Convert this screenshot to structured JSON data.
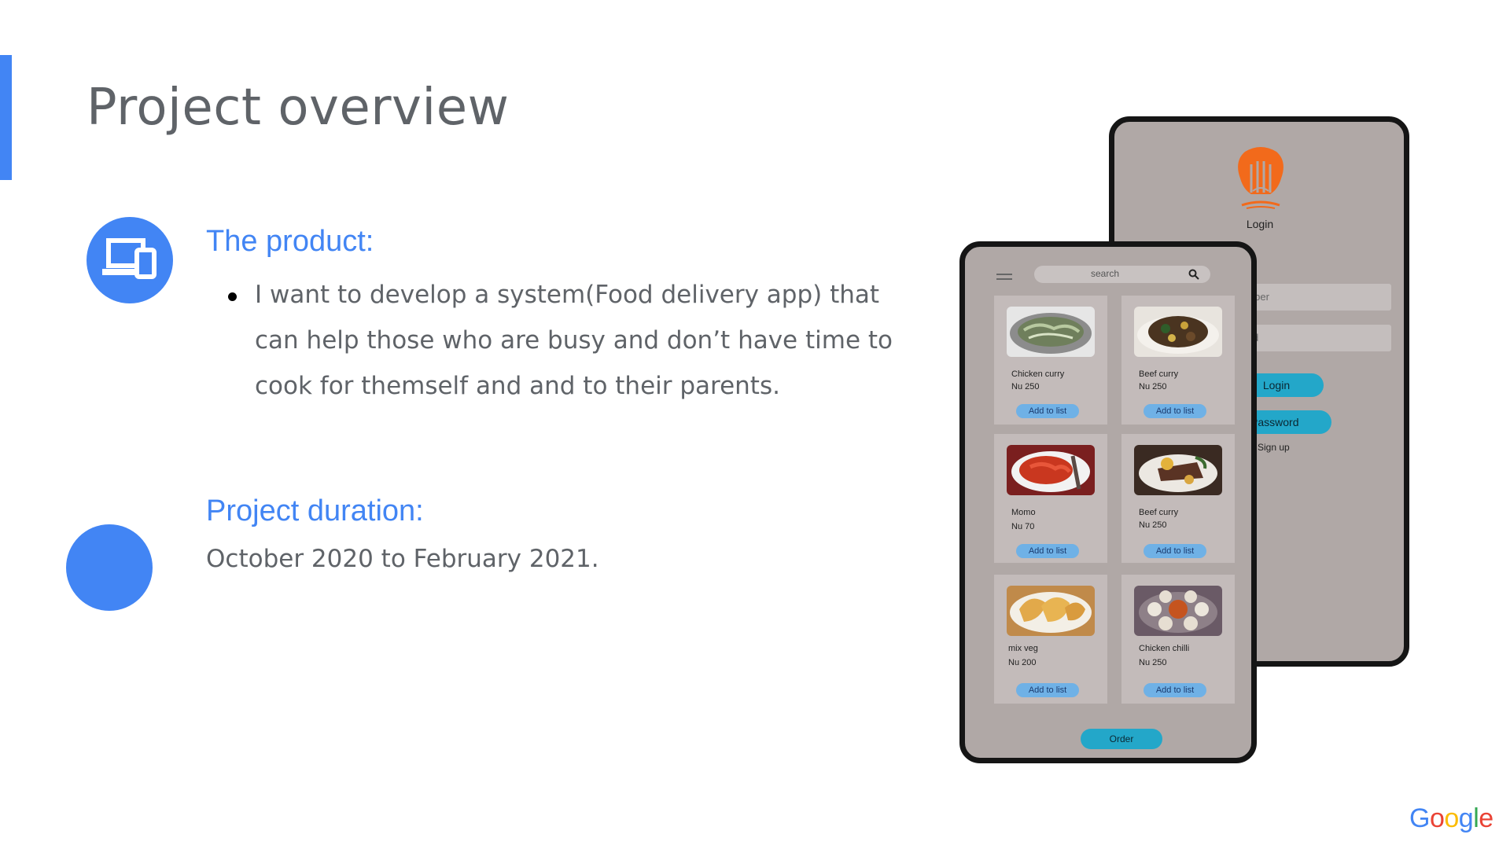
{
  "slide": {
    "title": "Project overview",
    "product": {
      "heading": "The product:",
      "bullets": [
        "I want to develop a system(Food delivery app) that can help those who are busy and don’t have time to cook for themself and and  to their parents."
      ]
    },
    "duration": {
      "heading": "Project duration:",
      "text": "October 2020 to February 2021."
    }
  },
  "login_screen": {
    "caption": "Login",
    "phone_placeholder": "e number",
    "password_placeholder": "ssword",
    "login_button": "Login",
    "forgot_button": "et Password",
    "signup_link": "Sign up"
  },
  "menu_screen": {
    "search_placeholder": "search",
    "order_button": "Order",
    "items": [
      {
        "name": "Chicken curry",
        "price": "Nu 250",
        "button": "Add to list"
      },
      {
        "name": "Beef  curry",
        "price": "Nu 250",
        "button": "Add to list"
      },
      {
        "name": "Momo",
        "price": "Nu 70",
        "button": "Add to list"
      },
      {
        "name": "Beef  curry",
        "price": "Nu 250",
        "button": "Add to list"
      },
      {
        "name": "mix veg",
        "price": "Nu 200",
        "button": "Add to list"
      },
      {
        "name": "Chicken chilli",
        "price": "Nu 250",
        "button": "Add to list"
      }
    ]
  },
  "branding": {
    "google": [
      "G",
      "o",
      "o",
      "g",
      "l",
      "e"
    ]
  },
  "colors": {
    "accent": "#4285f4",
    "text_gray": "#5f6368",
    "phone_screen": "#b0a8a6",
    "teal_button": "#23a7c9",
    "blue_button": "#6fb1e6",
    "logo_orange": "#f26a1b"
  },
  "icons": {
    "product": "devices-icon",
    "logo": "chef-logo-icon",
    "search": "search-icon",
    "menu": "menu-icon"
  }
}
